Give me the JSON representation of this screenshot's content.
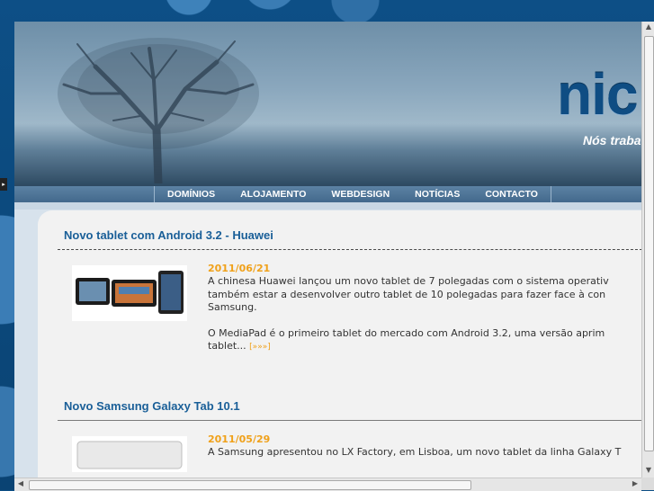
{
  "header": {
    "brand": "nic",
    "tagline": "Nós traba"
  },
  "nav": {
    "items": [
      {
        "label": "DOMÍNIOS"
      },
      {
        "label": "ALOJAMENTO"
      },
      {
        "label": "WEBDESIGN"
      },
      {
        "label": "NOTÍCIAS"
      },
      {
        "label": "CONTACTO"
      }
    ]
  },
  "articles": [
    {
      "title": "Novo tablet com Android 3.2 - Huawei",
      "date": "2011/06/21",
      "lines": [
        "A chinesa Huawei lançou um novo tablet de 7 polegadas com o sistema operativ",
        "também estar a desenvolver outro tablet de 10 polegadas para fazer face à con",
        "Samsung."
      ],
      "para2_lines": [
        "O MediaPad é o primeiro tablet do mercado com Android 3.2, uma versão aprim",
        "tablet... "
      ],
      "more": "[»»»]"
    },
    {
      "title": "Novo Samsung Galaxy Tab 10.1",
      "date": "2011/05/29",
      "lines": [
        "A Samsung apresentou no LX Factory, em Lisboa, um novo tablet da linha Galaxy T"
      ]
    }
  ],
  "colors": {
    "accent_blue": "#1a5f98",
    "date_orange": "#f0a11a",
    "outer_bg": "#0d4f86"
  }
}
